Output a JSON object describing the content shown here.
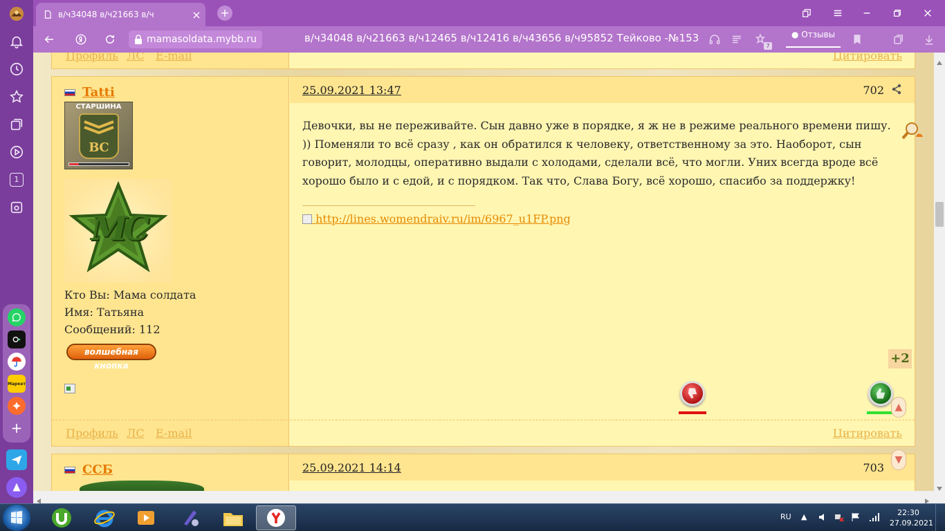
{
  "browser": {
    "tab_title": "в/ч34048 в/ч21663 в/ч",
    "domain": "mamasoldata.mybb.ru",
    "page_title": "в/ч34048 в/ч21663 в/ч12465 в/ч12416 в/ч43656 в/ч95852 Тейково -№153",
    "reviews_label": "Отзывы",
    "tabs_count": "7",
    "accent": "#b374cb"
  },
  "sidepanel": {
    "counter": "1",
    "market_label": "Маркет"
  },
  "prev_post": {
    "profile": "Профиль",
    "pm": "ЛС",
    "email": "E-mail",
    "quote": "Цитировать"
  },
  "post": {
    "author": "Tatti",
    "rank": "СТАРШИНА",
    "rank_letters": "ВС",
    "logo_text": "МС",
    "who_label": "Кто Вы: Мама солдата",
    "name_label": "Имя: Татьяна",
    "messages_label": "Сообщений: 112",
    "magic_button": "волшебная кнопка",
    "date": "25.09.2021 13:47",
    "number": "702",
    "text": "Девочки, вы не переживайте. Сын давно уже в порядке, я ж не в режиме реального времени пишу. )) Поменяли то всё сразу , как он обратился к человеку, ответственному за это.  Наоборот, сын говорит, молодцы, оперативно выдали с холодами, сделали всё, что могли. Уних всегда вроде всё хорошо было и с едой, и с порядком.  Так что,  Слава Богу, всё хорошо, спасибо за поддержку!",
    "signature_link": "http://lines.womendraiv.ru/im/6967_u1FP.png",
    "rating": "+2",
    "profile": "Профиль",
    "pm": "ЛС",
    "email": "E-mail",
    "quote": "Цитировать"
  },
  "next_post": {
    "author": "ССБ",
    "date": "25.09.2021 14:14",
    "number": "703"
  },
  "taskbar": {
    "lang": "RU",
    "time": "22:30",
    "date": "27.09.2021"
  }
}
